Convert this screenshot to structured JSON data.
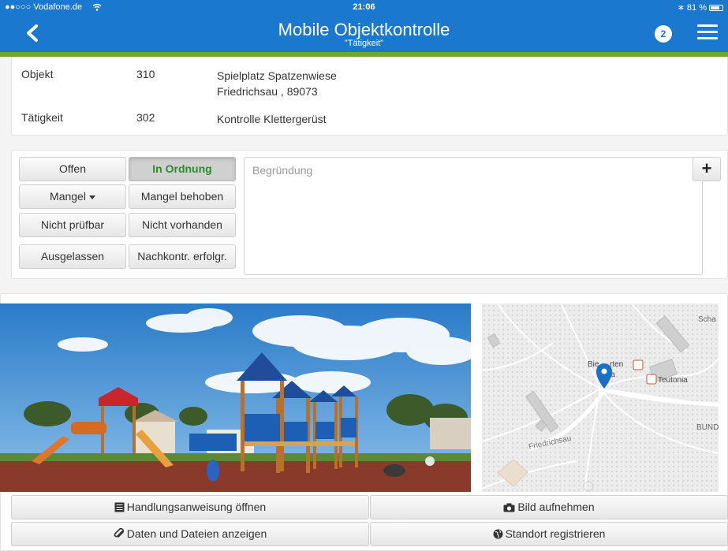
{
  "status_bar": {
    "carrier": "●●○○○ Vodafone.de",
    "time": "21:06",
    "battery": "81 %",
    "battery_level": 0.81
  },
  "nav": {
    "title": "Mobile Objektkontrolle",
    "subtitle": "\"Tätigkeit\"",
    "badge": "2",
    "back_icon": "chevron-left-icon",
    "menu_icon": "hamburger-icon"
  },
  "info": {
    "objekt_label": "Objekt",
    "objekt_number": "310",
    "objekt_name": "Spielplatz Spatzenwiese",
    "objekt_address": "Friedrichsau , 89073",
    "taetigkeit_label": "Tätigkeit",
    "taetigkeit_number": "302",
    "taetigkeit_name": "Kontrolle Klettergerüst"
  },
  "status_buttons": {
    "offen": "Offen",
    "in_ordnung": "In Ordnung",
    "mangel": "Mangel",
    "mangel_behoben": "Mangel behoben",
    "nicht_pruefbar": "Nicht prüfbar",
    "nicht_vorhanden": "Nicht vorhanden",
    "ausgelassen": "Ausgelassen",
    "nachkontr": "Nachkontr. erfolgr.",
    "active": "in_ordnung"
  },
  "reason": {
    "placeholder": "Begründung",
    "value": ""
  },
  "add_button": "+",
  "map": {
    "street": "Friedrichsau",
    "poi_1": "Bie",
    "poi_1b": "rten",
    "poi_1c": "onia",
    "poi_2": "Teutonia",
    "label_school": "Scha",
    "label_bund": "BUND"
  },
  "actions": {
    "handlungsanweisung": "Handlungsanweisung öffnen",
    "bild": "Bild aufnehmen",
    "daten": "Daten und Dateien anzeigen",
    "standort": "Standort registrieren"
  },
  "colors": {
    "header": "#1a78cf",
    "accent_bar": "#6aaa2d",
    "ok_text": "#2e8b2e"
  }
}
